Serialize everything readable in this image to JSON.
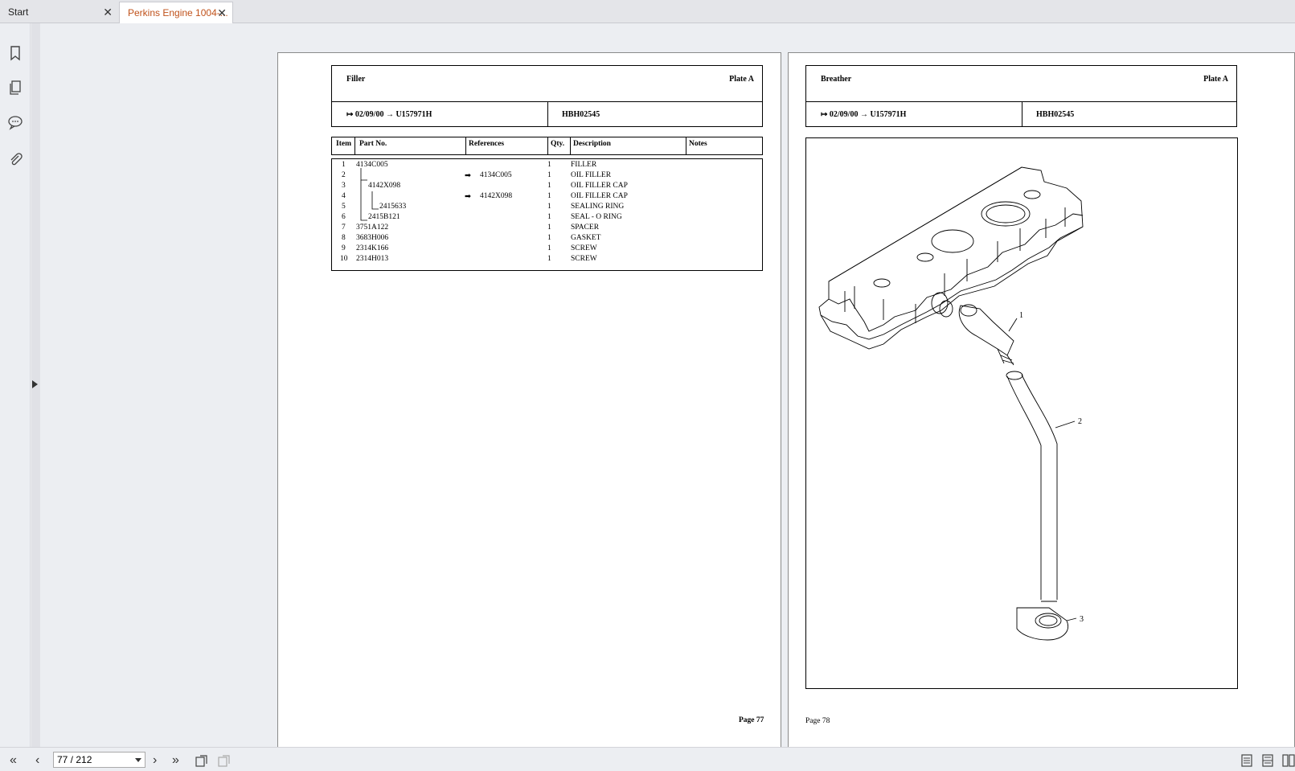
{
  "tabs": [
    {
      "label": "Start"
    },
    {
      "label": "Perkins Engine 1004-..."
    }
  ],
  "left_page": {
    "title": "Filler",
    "plate": "Plate A",
    "date": "02/09/00",
    "serial": "U157971H",
    "code": "HBH02545",
    "columns": [
      "Item",
      "Part No.",
      "References",
      "Qty.",
      "Description",
      "Notes"
    ],
    "rows": [
      {
        "item": "1",
        "part": "4134C005",
        "ref": "",
        "qty": "1",
        "desc": "FILLER"
      },
      {
        "item": "2",
        "part": "",
        "ref": "4134C005",
        "qty": "1",
        "desc": "OIL FILLER"
      },
      {
        "item": "3",
        "part": "4142X098",
        "ref": "",
        "qty": "1",
        "desc": "OIL FILLER CAP"
      },
      {
        "item": "4",
        "part": "",
        "ref": "4142X098",
        "qty": "1",
        "desc": "OIL FILLER CAP"
      },
      {
        "item": "5",
        "part": "2415633",
        "ref": "",
        "qty": "1",
        "desc": "SEALING RING"
      },
      {
        "item": "6",
        "part": "2415B121",
        "ref": "",
        "qty": "1",
        "desc": "SEAL - O RING"
      },
      {
        "item": "7",
        "part": "3751A122",
        "ref": "",
        "qty": "1",
        "desc": "SPACER"
      },
      {
        "item": "8",
        "part": "3683H006",
        "ref": "",
        "qty": "1",
        "desc": "GASKET"
      },
      {
        "item": "9",
        "part": "2314K166",
        "ref": "",
        "qty": "1",
        "desc": "SCREW"
      },
      {
        "item": "10",
        "part": "2314H013",
        "ref": "",
        "qty": "1",
        "desc": "SCREW"
      }
    ],
    "page_label": "Page 77"
  },
  "right_page": {
    "title": "Breather",
    "plate": "Plate A",
    "date": "02/09/00",
    "serial": "U157971H",
    "code": "HBH02545",
    "callouts": [
      "1",
      "2",
      "3"
    ],
    "page_label": "Page 78"
  },
  "bottom": {
    "page_indicator": "77 / 212"
  },
  "icons": [
    "bookmark-icon",
    "pages-icon",
    "comment-icon",
    "attachment-icon",
    "first-page-icon",
    "prev-page-icon",
    "next-page-icon",
    "last-page-icon"
  ]
}
